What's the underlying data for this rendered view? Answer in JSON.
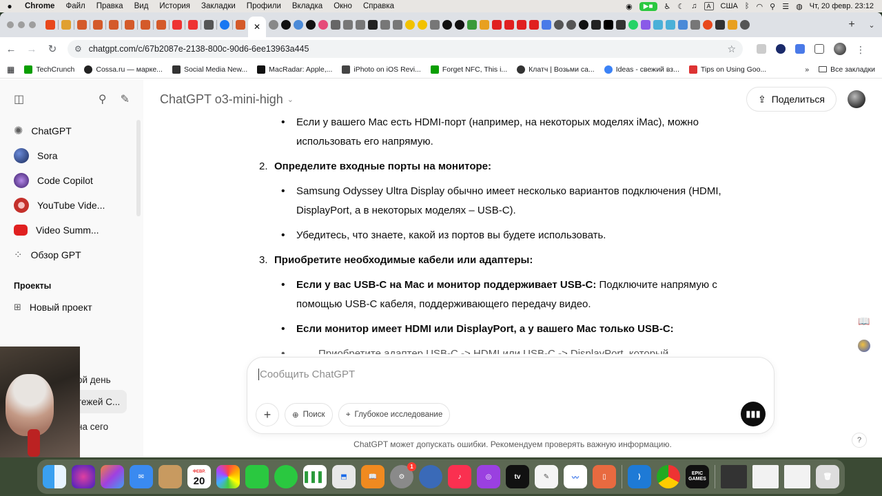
{
  "menubar": {
    "app": "Chrome",
    "items": [
      "Файл",
      "Правка",
      "Вид",
      "История",
      "Закладки",
      "Профили",
      "Вкладка",
      "Окно",
      "Справка"
    ],
    "input_source": "США",
    "datetime": "Чт, 20 февр.  23:12"
  },
  "browser": {
    "url": "chatgpt.com/c/67b2087e-2138-800c-90d6-6ee13963a445",
    "active_tab_close": "✕",
    "bookmarks": [
      {
        "label": "TechCrunch",
        "color": "#0a9e01"
      },
      {
        "label": "Cossa.ru — марке...",
        "color": "#222222"
      },
      {
        "label": "Social Media New...",
        "color": "#333333"
      },
      {
        "label": "MacRadar: Apple,...",
        "color": "#111111"
      },
      {
        "label": "iPhoto on iOS Revi...",
        "color": "#444444"
      },
      {
        "label": "Forget NFC, This i...",
        "color": "#0a9e01"
      },
      {
        "label": "Клатч | Возьми са...",
        "color": "#333333"
      },
      {
        "label": "Ideas - свежий вз...",
        "color": "#3b82f6"
      },
      {
        "label": "Tips on Using Goo...",
        "color": "#d33"
      }
    ],
    "all_bookmarks": "Все закладки"
  },
  "sidebar": {
    "nav": [
      {
        "label": "ChatGPT",
        "icon": "openai-icon",
        "color": "#ffffff"
      },
      {
        "label": "Sora",
        "icon": "sora-icon",
        "color": "#2c3e8f"
      },
      {
        "label": "Code Copilot",
        "icon": "copilot-icon",
        "color": "#5b2a86"
      },
      {
        "label": "YouTube Vide...",
        "icon": "youtube-icon",
        "color": "#c4302b"
      },
      {
        "label": "Video Summ...",
        "icon": "video-summary-icon",
        "color": "#e02020"
      },
      {
        "label": "Обзор GPT",
        "icon": "explore-grid-icon",
        "color": "#ffffff"
      }
    ],
    "projects_title": "Проекты",
    "new_project": "Новый проект",
    "chats": [
      "ой день",
      "тежей С...",
      "на сего"
    ]
  },
  "header": {
    "model": "ChatGPT o3-mini-high",
    "share": "Поделиться"
  },
  "message": {
    "b1": "Если у вашего Mac есть HDMI-порт (например, на некоторых моделях iMac), можно использовать его напрямую.",
    "s2_num": "2.",
    "s2": "Определите входные порты на мониторе:",
    "b2a": "Samsung Odyssey Ultra Display обычно имеет несколько вариантов подключения (HDMI, DisplayPort, а в некоторых моделях – USB-C).",
    "b2b": "Убедитесь, что знаете, какой из портов вы будете использовать.",
    "s3_num": "3.",
    "s3": "Приобретите необходимые кабели или адаптеры:",
    "b3a_bold": "Если у вас USB-C на Mac и монитор поддерживает USB-C:",
    "b3a_rest": " Подключите напрямую с помощью USB-C кабеля, поддерживающего передачу видео.",
    "b3b_bold": "Если монитор имеет HDMI или DisplayPort, а у вашего Mac только USB-C:",
    "b3c_partial": "Приобретите адаптер USB-C -> HDMI или USB-C -> DisplayPort, который"
  },
  "composer": {
    "placeholder": "Сообщить ChatGPT",
    "search": "Поиск",
    "deep_research": "Глубокое исследование"
  },
  "footer": {
    "disclaimer": "ChatGPT может допускать ошибки. Рекомендуем проверять важную информацию.",
    "help": "?"
  },
  "dock": {
    "calendar_month": "ФЕВР.",
    "calendar_day": "20",
    "settings_badge": "1",
    "appletv": "tv",
    "epic": "EPIC GAMES"
  }
}
